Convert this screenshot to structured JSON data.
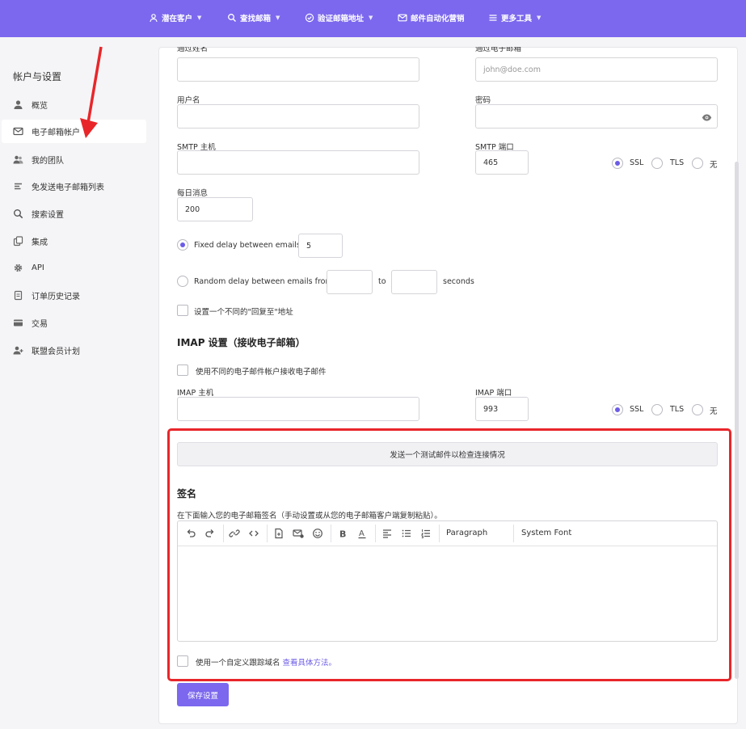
{
  "topnav": {
    "items": [
      {
        "label": "潜在客户",
        "icon": "user-icon"
      },
      {
        "label": "查找邮箱",
        "icon": "search-icon"
      },
      {
        "label": "验证邮箱地址",
        "icon": "check-circle-icon"
      },
      {
        "label": "邮件自动化营销",
        "icon": "mail-icon"
      },
      {
        "label": "更多工具",
        "icon": "menu-icon"
      }
    ]
  },
  "sidebar": {
    "title": "帐户与设置",
    "items": [
      {
        "label": "概览",
        "icon": "user-icon"
      },
      {
        "label": "电子邮箱帐户",
        "icon": "mail-icon",
        "active": true
      },
      {
        "label": "我的团队",
        "icon": "team-icon"
      },
      {
        "label": "免发送电子邮箱列表",
        "icon": "list-icon"
      },
      {
        "label": "搜索设置",
        "icon": "search-icon"
      },
      {
        "label": "集成",
        "icon": "integration-icon"
      },
      {
        "label": "API",
        "icon": "gear-icon"
      },
      {
        "label": "订单历史记录",
        "icon": "document-icon"
      },
      {
        "label": "交易",
        "icon": "card-icon"
      },
      {
        "label": "联盟会员计划",
        "icon": "add-user-icon"
      }
    ]
  },
  "form": {
    "sender_name_label": "通过姓名",
    "sender_email_label": "通过电子邮箱",
    "sender_email_placeholder": "john@doe.com",
    "username_label": "用户名",
    "password_label": "密码",
    "smtp_host_label": "SMTP 主机",
    "smtp_port_label": "SMTP 端口",
    "smtp_port_value": "465",
    "security": {
      "ssl": "SSL",
      "tls": "TLS",
      "none": "无",
      "selected": "SSL"
    },
    "daily_label": "每日消息",
    "daily_value": "200",
    "fixed_delay_label": "Fixed delay between emails:",
    "fixed_delay_value": "5",
    "random_delay_label": "Random delay between emails from:",
    "random_to": "to",
    "random_unit": "seconds",
    "reply_to_label": "设置一个不同的\"回复至\"地址"
  },
  "imap": {
    "title": "IMAP 设置（接收电子邮箱）",
    "use_different_label": "使用不同的电子邮件帐户接收电子邮件",
    "host_label": "IMAP 主机",
    "port_label": "IMAP 端口",
    "port_value": "993",
    "security": {
      "ssl": "SSL",
      "tls": "TLS",
      "none": "无",
      "selected": "SSL"
    }
  },
  "test_button": "发送一个测试邮件以检查连接情况",
  "signature": {
    "title": "签名",
    "description": "在下面输入您的电子邮箱签名（手动设置或从您的电子邮箱客户端复制粘贴）。",
    "paragraph_select": "Paragraph",
    "font_select": "System Font",
    "custom_domain_label": "使用一个自定义跟踪域名",
    "custom_domain_link": "查看具体方法。"
  },
  "save_button": "保存设置",
  "colors": {
    "accent": "#7b68ee",
    "highlight": "#e8262a"
  }
}
